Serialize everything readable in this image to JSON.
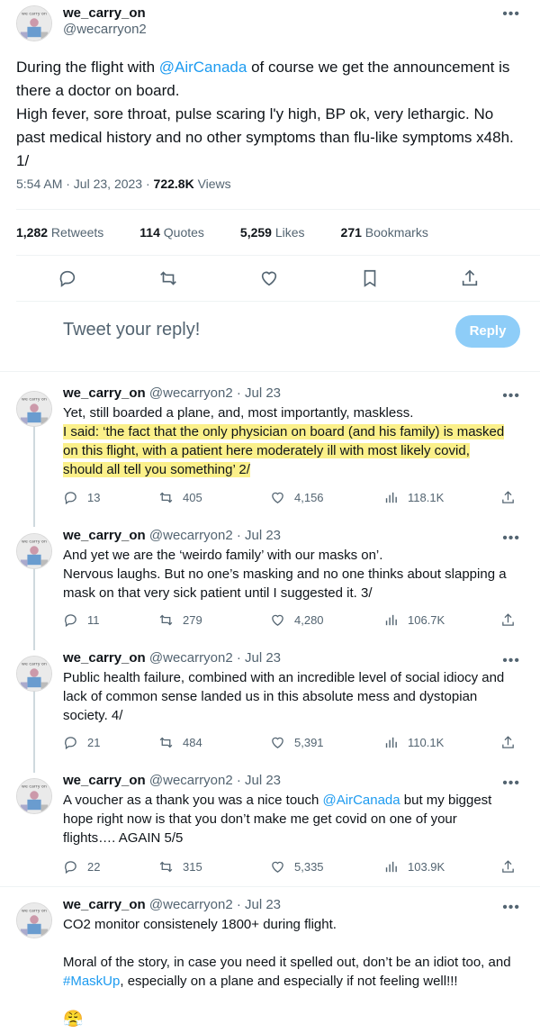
{
  "main_tweet": {
    "display_name": "we_carry_on",
    "handle": "@wecarryon2",
    "text_prefix": "During the flight with ",
    "mention": "@AirCanada",
    "text_suffix": " of course we get the announcement is there a doctor on board.",
    "text_line2": "High fever, sore throat, pulse scaring l'y high, BP ok, very lethargic. No past medical history and no other  symptoms than flu-like symptoms x48h. 1/",
    "time": "5:54 AM · Jul 23, 2023 · ",
    "views_count": "722.8K",
    "views_label": " Views",
    "stats": {
      "retweets": "1,282",
      "retweets_label": " Retweets",
      "quotes": "114",
      "quotes_label": " Quotes",
      "likes": "5,259",
      "likes_label": " Likes",
      "bookmarks": "271",
      "bookmarks_label": " Bookmarks"
    }
  },
  "reply_box": {
    "placeholder": "Tweet your reply!",
    "button": "Reply"
  },
  "replies": [
    {
      "display_name": "we_carry_on",
      "meta": "@wecarryon2 · Jul 23",
      "line1": "Yet, still boarded a plane, and, most importantly, maskless.",
      "highlight": "I said: ‘the fact that the only physician on board (and his family) is masked on this flight, with a patient here moderately ill with most likely covid, should all tell you something’ 2/",
      "comments": "13",
      "retweets": "405",
      "likes": "4,156",
      "views": "118.1K"
    },
    {
      "display_name": "we_carry_on",
      "meta": "@wecarryon2 · Jul 23",
      "line1": "And yet we are the ‘weirdo family’ with our masks on’.",
      "line2": "Nervous laughs. But no one’s masking and no one thinks about slapping a mask on that very sick patient until I suggested it. 3/",
      "comments": "11",
      "retweets": "279",
      "likes": "4,280",
      "views": "106.7K"
    },
    {
      "display_name": "we_carry_on",
      "meta": "@wecarryon2 · Jul 23",
      "line1": "Public health failure, combined with an incredible level of social idiocy and lack of common sense landed us in this absolute mess and dystopian society. 4/",
      "comments": "21",
      "retweets": "484",
      "likes": "5,391",
      "views": "110.1K"
    },
    {
      "display_name": "we_carry_on",
      "meta": "@wecarryon2 · Jul 23",
      "text_prefix": "A voucher as a thank you was a nice touch ",
      "mention": "@AirCanada",
      "text_suffix": "  but my biggest hope right now is that you don’t make me get covid on one of your flights…. AGAIN 5/5",
      "comments": "22",
      "retweets": "315",
      "likes": "5,335",
      "views": "103.9K"
    },
    {
      "display_name": "we_carry_on",
      "meta": "@wecarryon2 · Jul 23",
      "line1": "CO2 monitor consistenely 1800+ during flight.",
      "line2_prefix": "Moral of the story, in case you need it spelled out, don’t be an idiot too, and ",
      "hashtag": "#MaskUp",
      "line2_suffix": ", especially on a plane and especially if not feeling well!!!",
      "emoji": "😤"
    }
  ],
  "icons": {
    "more": "more-icon",
    "comment": "comment-icon",
    "retweet": "retweet-icon",
    "like": "heart-icon",
    "bookmark": "bookmark-icon",
    "share": "share-icon",
    "views": "views-icon"
  },
  "colors": {
    "accent": "#1d9bf0",
    "reply_button": "#8ecdf8",
    "highlight": "#fbf08a",
    "muted": "#536471"
  }
}
